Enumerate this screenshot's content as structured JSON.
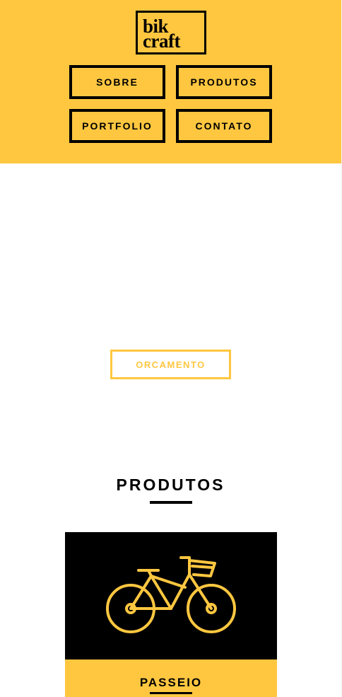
{
  "header": {
    "logo": {
      "line1": "bik",
      "line2": "craft"
    },
    "nav": [
      {
        "label": "SOBRE"
      },
      {
        "label": "PRODUTOS"
      },
      {
        "label": "PORTFOLIO"
      },
      {
        "label": "CONTATO"
      }
    ]
  },
  "hero": {
    "cta_label": "ORCAMENTO"
  },
  "produtos": {
    "title": "PRODUTOS",
    "items": [
      {
        "name": "PASSEIO",
        "icon": "bicycle-icon"
      }
    ]
  },
  "colors": {
    "brand_yellow": "#FFC740",
    "black": "#000000",
    "white": "#FFFFFF"
  }
}
